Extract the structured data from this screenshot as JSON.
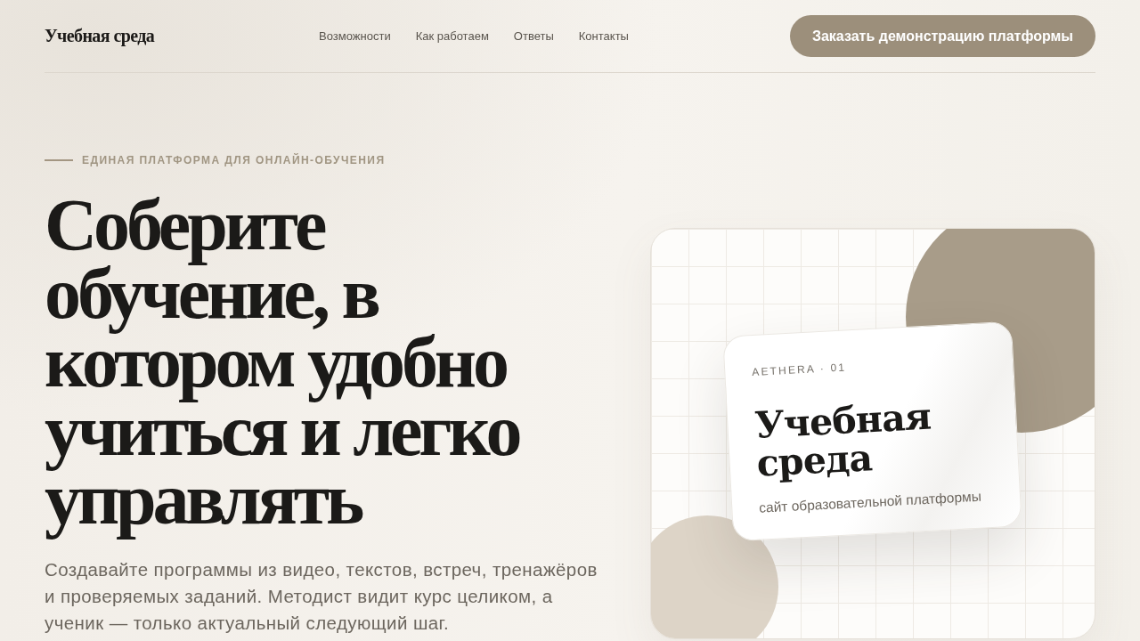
{
  "header": {
    "logo": "Учебная среда",
    "nav": [
      "Возможности",
      "Как работаем",
      "Ответы",
      "Контакты"
    ],
    "cta": "Заказать демонстрацию платформы"
  },
  "hero": {
    "eyebrow": "ЕДИНАЯ ПЛАТФОРМА ДЛЯ ОНЛАЙН-ОБУЧЕНИЯ",
    "heading": "Соберите обучение, в котором удобно учиться и легко управлять",
    "description": "Создавайте программы из видео, текстов, встреч, тренажёров и проверяемых заданий. Методист видит курс целиком, а ученик — только актуальный следующий шаг."
  },
  "illustration": {
    "card": {
      "label": "AETHERA · 01",
      "title": "Учебная среда",
      "subtitle": "сайт образовательной платформы"
    }
  }
}
